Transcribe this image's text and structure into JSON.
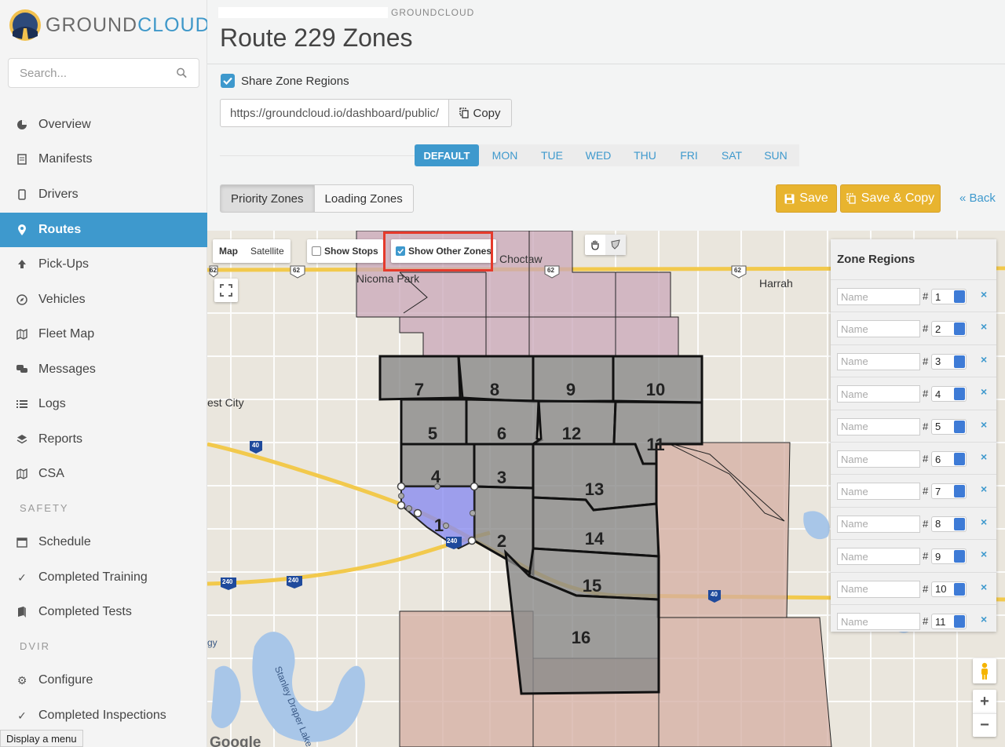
{
  "brand": {
    "name_part1": "GROUND",
    "name_part2": "CLOUD"
  },
  "search": {
    "placeholder": "Search..."
  },
  "nav": {
    "items": [
      {
        "label": "Overview",
        "icon": "pie-chart-icon"
      },
      {
        "label": "Manifests",
        "icon": "document-icon"
      },
      {
        "label": "Drivers",
        "icon": "mobile-phone-icon"
      },
      {
        "label": "Routes",
        "icon": "map-pin-icon",
        "active": true
      },
      {
        "label": "Pick-Ups",
        "icon": "upload-arrow-icon"
      },
      {
        "label": "Vehicles",
        "icon": "compass-icon"
      },
      {
        "label": "Fleet Map",
        "icon": "map-icon"
      },
      {
        "label": "Messages",
        "icon": "chat-bubbles-icon"
      },
      {
        "label": "Logs",
        "icon": "list-icon"
      },
      {
        "label": "Reports",
        "icon": "layers-icon"
      },
      {
        "label": "CSA",
        "icon": "map-icon"
      }
    ],
    "safety_label": "SAFETY",
    "safety_items": [
      {
        "label": "Schedule",
        "icon": "calendar-icon"
      },
      {
        "label": "Completed Training",
        "icon": "check-icon"
      },
      {
        "label": "Completed Tests",
        "icon": "book-icon"
      }
    ],
    "dvir_label": "DVIR",
    "dvir_items": [
      {
        "label": "Configure",
        "icon": "gear-icon"
      },
      {
        "label": "Completed Inspections",
        "icon": "check-icon"
      }
    ]
  },
  "tooltip": "Display a menu",
  "header": {
    "breadcrumb": "GROUNDCLOUD",
    "title": "Route 229 Zones"
  },
  "share": {
    "label": "Share Zone Regions",
    "checked": true,
    "url": "https://groundcloud.io/dashboard/public/",
    "copy_label": "Copy"
  },
  "days": {
    "tabs": [
      "DEFAULT",
      "MON",
      "TUE",
      "WED",
      "THU",
      "FRI",
      "SAT",
      "SUN"
    ],
    "active": "DEFAULT"
  },
  "zone_types": {
    "priority": "Priority Zones",
    "loading": "Loading Zones",
    "active": "Priority Zones"
  },
  "actions": {
    "save": "Save",
    "save_copy": "Save & Copy",
    "back": "« Back"
  },
  "map": {
    "type_map": "Map",
    "type_satellite": "Satellite",
    "show_stops": "Show Stops",
    "show_stops_checked": false,
    "show_other_zones": "Show Other Zones",
    "show_other_zones_checked": true,
    "place_labels": [
      "Choctaw",
      "Nicoma Park",
      "Harrah",
      "est City",
      "Stanley Draper Lake",
      "gy"
    ],
    "highway_shields": [
      "62",
      "62",
      "62",
      "62",
      "40",
      "240",
      "240",
      "240",
      "40"
    ],
    "zone_numbers": [
      "1",
      "2",
      "3",
      "4",
      "5",
      "6",
      "7",
      "8",
      "9",
      "10",
      "11",
      "12",
      "13",
      "14",
      "15",
      "16"
    ],
    "attribution": "Google",
    "colors": {
      "other_zones_purple": "#c9a7b8",
      "other_zones_tan": "#d4aea2",
      "route_zones_gray": "#8a8a8a",
      "selected_zone": "#8a8cf0",
      "highlight_box": "#e53a2c"
    }
  },
  "zone_regions": {
    "title": "Zone Regions",
    "name_placeholder": "Name",
    "rows": [
      {
        "number": "1"
      },
      {
        "number": "2"
      },
      {
        "number": "3"
      },
      {
        "number": "4"
      },
      {
        "number": "5"
      },
      {
        "number": "6"
      },
      {
        "number": "7"
      },
      {
        "number": "8"
      },
      {
        "number": "9"
      },
      {
        "number": "10"
      },
      {
        "number": "11"
      }
    ],
    "delete_label": "×"
  }
}
